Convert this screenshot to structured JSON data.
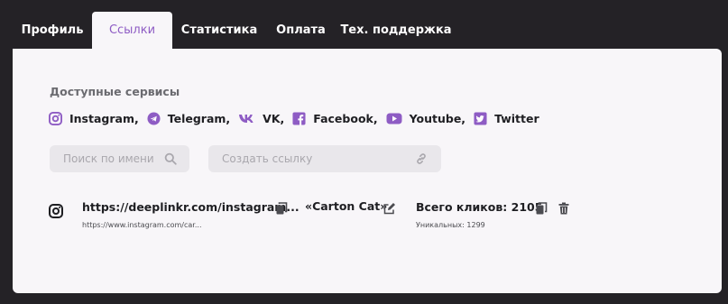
{
  "tabs": [
    {
      "label": "Профиль",
      "active": false
    },
    {
      "label": "Ссылки",
      "active": true
    },
    {
      "label": "Статистика",
      "active": false
    },
    {
      "label": "Оплата",
      "active": false
    },
    {
      "label": "Тех. поддержка",
      "active": false
    }
  ],
  "services": {
    "title": "Доступные сервисы",
    "items": [
      {
        "label": "Instagram,",
        "icon": "instagram-icon"
      },
      {
        "label": "Telegram,",
        "icon": "telegram-icon"
      },
      {
        "label": "VK,",
        "icon": "vk-icon"
      },
      {
        "label": "Facebook,",
        "icon": "facebook-icon"
      },
      {
        "label": "Youtube,",
        "icon": "youtube-icon"
      },
      {
        "label": "Twitter",
        "icon": "twitter-icon"
      }
    ]
  },
  "search": {
    "placeholder": "Поиск по имени",
    "icon": "search-icon"
  },
  "create_link": {
    "placeholder": "Создать ссылку",
    "icon": "link-icon"
  },
  "links": [
    {
      "service_icon": "instagram-icon",
      "short_url": "https://deeplinkr.com/instagram...",
      "original_url": "https://www.instagram.com/car...",
      "name": "«Carton Cat»",
      "total_clicks": "Всего кликов: 2105",
      "unique_clicks": "Уникальных: 1299"
    }
  ],
  "colors": {
    "accent": "#8e5cc4",
    "background": "#242226",
    "card": "#f8f6f9",
    "input_bg": "#e9e7eb"
  }
}
